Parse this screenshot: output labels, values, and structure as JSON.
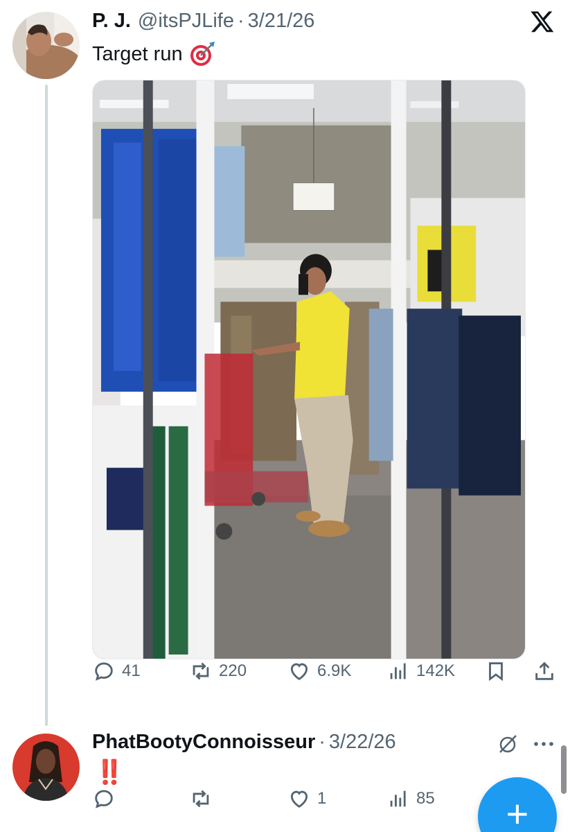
{
  "tweet": {
    "author_name": "P. J.",
    "handle": "@itsPJLife",
    "separator": "·",
    "date": "3/21/26",
    "text": "Target run",
    "emoji": "direct-hit-target-emoji",
    "image_alt": "mirror selfie in Target clothing aisle",
    "stats": {
      "replies": "41",
      "reposts": "220",
      "likes": "6.9K",
      "views": "142K"
    }
  },
  "reply": {
    "author_name": "PhatBootyConnoisseur",
    "separator": "·",
    "date": "3/22/26",
    "text": "‼️",
    "stats": {
      "replies": "",
      "reposts": "",
      "likes": "1",
      "views": "85"
    }
  },
  "compose_button": {
    "label": "+"
  },
  "icons": {
    "brand": "x-logo-icon",
    "reply": "reply-bubble-icon",
    "repost": "repost-icon",
    "like": "heart-icon",
    "views": "views-bar-chart-icon",
    "bookmark": "bookmark-icon",
    "share": "share-upload-icon",
    "grok": "grok-slash-icon",
    "more": "more-dots-icon"
  },
  "colors": {
    "text_primary": "#0f1419",
    "text_secondary": "#536471",
    "accent_blue": "#1d9bf0",
    "emphasis_red": "#f4212e",
    "thread_line": "#cfd9de"
  }
}
